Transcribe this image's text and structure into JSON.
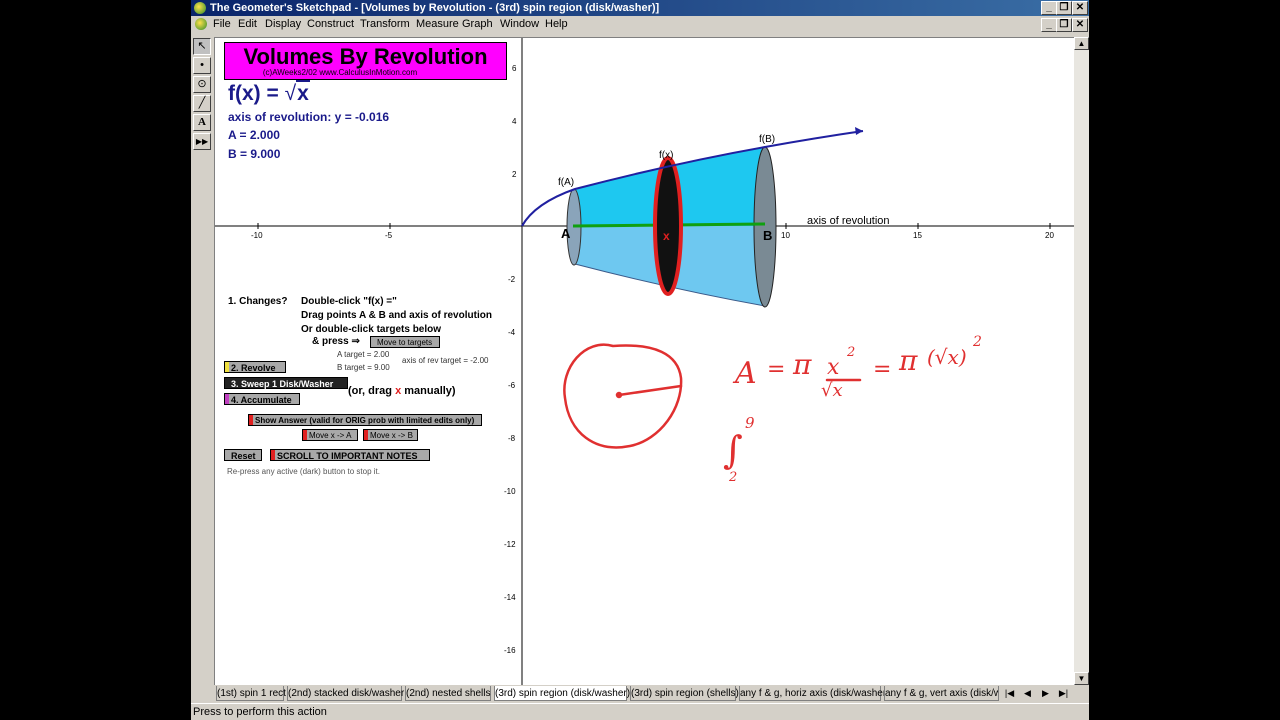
{
  "window": {
    "title": "The Geometer's Sketchpad - [Volumes by Revolution - (3rd) spin region (disk/washer)]",
    "controls": [
      "_",
      "❐",
      "✕"
    ]
  },
  "menu": [
    "File",
    "Edit",
    "Display",
    "Construct",
    "Transform",
    "Measure",
    "Graph",
    "Window",
    "Help"
  ],
  "toolbox": {
    "tools": [
      {
        "name": "arrow-tool-icon",
        "glyph": "↖"
      },
      {
        "name": "point-tool-icon",
        "glyph": "•"
      },
      {
        "name": "compass-tool-icon",
        "glyph": "⊙"
      },
      {
        "name": "straightedge-tool-icon",
        "glyph": "╱"
      },
      {
        "name": "text-tool-icon",
        "glyph": "A"
      },
      {
        "name": "custom-tool-icon",
        "glyph": "▶▶"
      }
    ]
  },
  "sketch": {
    "title": "Volumes By Revolution",
    "copyright": "(c)AWeeks2/02 www.CalculusInMotion.com",
    "function_prefix": "f(x) = ",
    "function_radical": "x",
    "axis_of_revolution": "axis of revolution: y = -0.016",
    "a_value": "A = 2.000",
    "b_value": "B = 9.000",
    "instructions": {
      "step1": "1. Changes?",
      "line1": "Double-click \"f(x) =\"",
      "line2": "Drag points A & B and axis of revolution",
      "line3": "Or double-click targets below",
      "line4": "& press ⇒"
    },
    "targets": {
      "a_target": "A target = 2.00",
      "b_target": "B target = 9.00",
      "axis_target": "axis of rev target = -2.00"
    },
    "buttons": {
      "move_to_targets": "Move to targets",
      "revolve": "2. Revolve",
      "sweep": "3. Sweep 1 Disk/Washer",
      "accumulate": "4. Accumulate",
      "show_answer": "Show Answer (valid for ORIG prob with limited edits only)",
      "move_x_a": "Move x -> A",
      "move_x_b": "Move x -> B",
      "reset": "Reset",
      "scroll_notes": "SCROLL TO IMPORTANT NOTES"
    },
    "drag_note_prefix": "(or, drag ",
    "drag_note_x": "x",
    "drag_note_suffix": " manually)",
    "repress_note": "Re-press any active (dark) button to stop it.",
    "graph_labels": {
      "fA": "f(A)",
      "fx": "f(x)",
      "fB": "f(B)",
      "A": "A",
      "B": "B",
      "x": "x",
      "axis": "axis of revolution"
    },
    "x_ticks": [
      "-10",
      "-5",
      "5",
      "10",
      "15",
      "20"
    ],
    "y_ticks": [
      "6",
      "4",
      "2",
      "-2",
      "-4",
      "-6",
      "-8",
      "-10",
      "-12",
      "-14",
      "-16"
    ],
    "colors": {
      "curve": "#2020a0",
      "solid_top": "#1ec8f0",
      "solid_bottom": "#6ec8f0",
      "disk_ring": "#e02020",
      "green_axis": "#10a010",
      "ink": "#e03030",
      "title_bg": "#ff00ff"
    }
  },
  "annotations": {
    "eq_A": "A",
    "eq_eq1": "=",
    "eq_pi1": "π",
    "eq_num": "x",
    "eq_sup1": "2",
    "eq_den": "√x",
    "eq_eq2": "=",
    "eq_pi2": "π",
    "eq_paren": "(√x)",
    "eq_sup2": "2",
    "int_sym": "∫",
    "int_upper": "9",
    "int_lower": "2"
  },
  "tabs": [
    {
      "label": "(1st)  spin 1 rect",
      "active": false
    },
    {
      "label": "(2nd) stacked disk/washer",
      "active": false
    },
    {
      "label": "(2nd)  nested shells",
      "active": false
    },
    {
      "label": "(3rd) spin region (disk/washer)",
      "active": true
    },
    {
      "label": "(3rd) spin region (shells)",
      "active": false
    },
    {
      "label": "any f & g, horiz axis (disk/washer)",
      "active": false
    },
    {
      "label": "any f & g, vert axis (disk/wa",
      "active": false
    }
  ],
  "tab_nav": [
    "|◀",
    "◀",
    "▶",
    "▶|"
  ],
  "status": "Press to perform this action"
}
